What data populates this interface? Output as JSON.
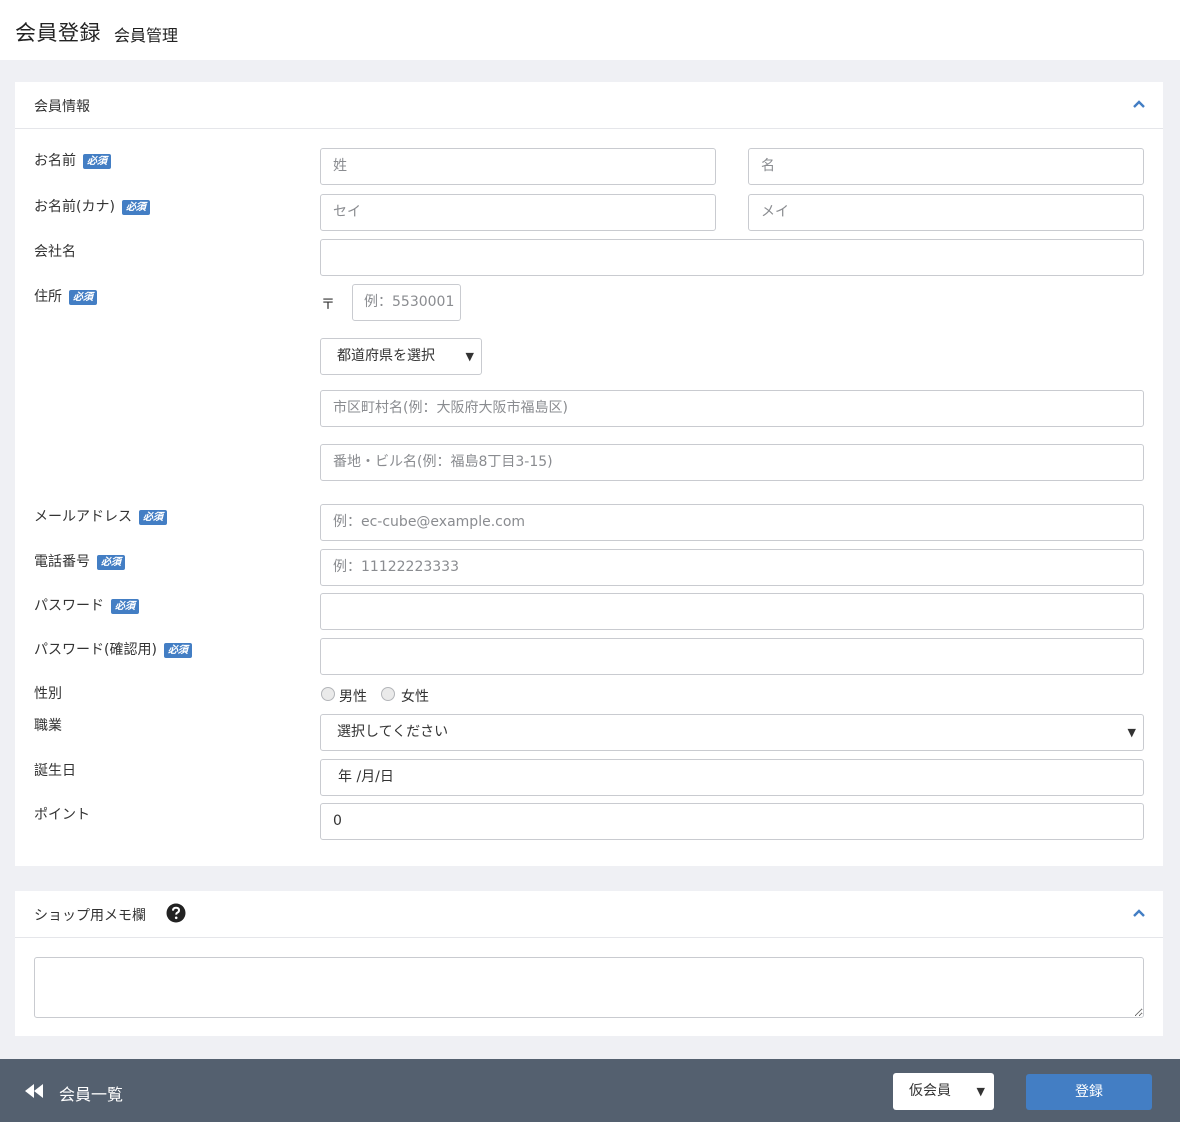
{
  "header": {
    "title": "会員登録",
    "subtitle": "会員管理"
  },
  "member_info": {
    "title": "会員情報",
    "required_badge": "必須",
    "labels": {
      "name": "お名前",
      "kana": "お名前(カナ)",
      "company": "会社名",
      "address": "住所",
      "email": "メールアドレス",
      "phone": "電話番号",
      "password": "パスワード",
      "password_confirm": "パスワード(確認用)",
      "sex": "性別",
      "job": "職業",
      "birth": "誕生日",
      "point": "ポイント"
    },
    "placeholders": {
      "last_name": "姓",
      "first_name": "名",
      "last_kana": "セイ",
      "first_kana": "メイ",
      "postal": "例：5530001",
      "city": "市区町村名(例：大阪府大阪市福島区)",
      "street": "番地・ビル名(例：福島8丁目3-15)",
      "email": "例：ec-cube@example.com",
      "phone": "例：11122223333"
    },
    "postal_mark": "〒",
    "pref_select": "都道府県を選択",
    "sex_options": [
      "男性",
      "女性"
    ],
    "job_select": "選択してください",
    "birth_value": "年 /月/日",
    "point_value": "0"
  },
  "memo": {
    "title": "ショップ用メモ欄"
  },
  "footer": {
    "back_label": "会員一覧",
    "status_select": "仮会員",
    "submit_label": "登録"
  },
  "colors": {
    "accent": "#437ec4",
    "footer_bg": "#54606f",
    "page_bg": "#eff0f4"
  }
}
